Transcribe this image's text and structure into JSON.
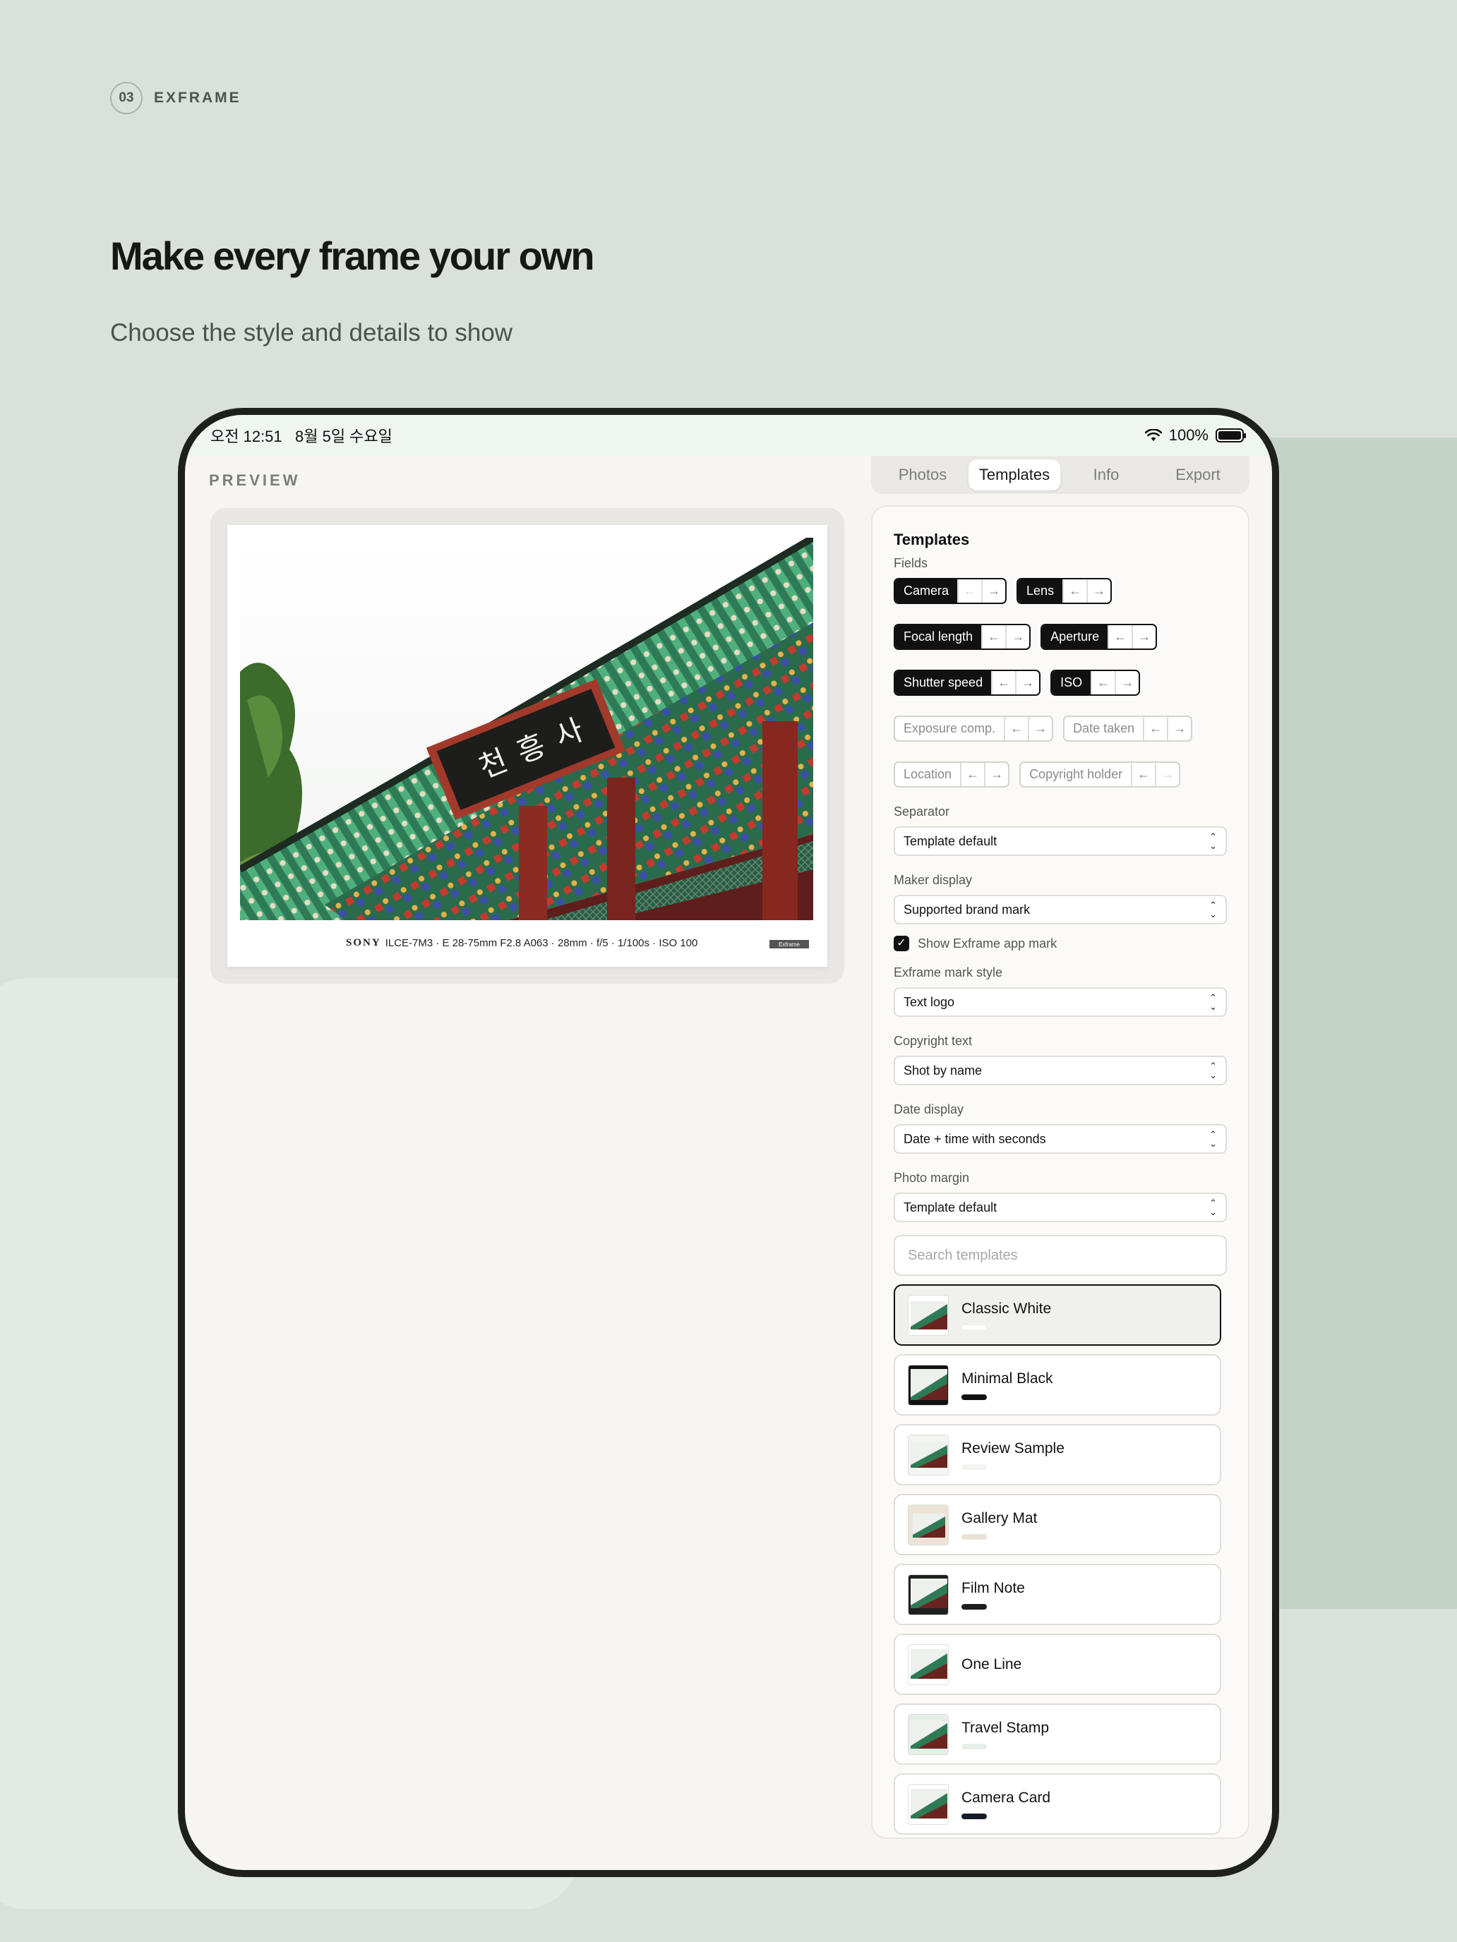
{
  "badge": {
    "number": "03",
    "label": "EXFRAME"
  },
  "headline": "Make every frame your own",
  "subhead": "Choose the style and details to show",
  "statusbar": {
    "time": "오전 12:51",
    "date": "8월 5일 수요일",
    "battery": "100%"
  },
  "preview": {
    "label": "PREVIEW",
    "caption_brand": "SONY",
    "caption_text": "ILCE-7M3 · E 28-75mm F2.8 A063 · 28mm · f/5 · 1/100s · ISO 100",
    "mark": "Exframe"
  },
  "tabs": [
    {
      "label": "Photos"
    },
    {
      "label": "Templates"
    },
    {
      "label": "Info"
    },
    {
      "label": "Export"
    }
  ],
  "panel": {
    "title": "Templates",
    "fields_label": "Fields",
    "fields": [
      {
        "name": "Camera",
        "on": true
      },
      {
        "name": "Lens",
        "on": true
      },
      {
        "name": "Focal length",
        "on": true
      },
      {
        "name": "Aperture",
        "on": true
      },
      {
        "name": "Shutter speed",
        "on": true
      },
      {
        "name": "ISO",
        "on": true
      },
      {
        "name": "Exposure comp.",
        "on": false
      },
      {
        "name": "Date taken",
        "on": false
      },
      {
        "name": "Location",
        "on": false
      },
      {
        "name": "Copyright holder",
        "on": false
      }
    ],
    "separator": {
      "label": "Separator",
      "value": "Template default"
    },
    "maker": {
      "label": "Maker display",
      "value": "Supported brand mark"
    },
    "show_mark": {
      "label": "Show Exframe app mark",
      "checked": true
    },
    "mark_style": {
      "label": "Exframe mark style",
      "value": "Text logo"
    },
    "copyright": {
      "label": "Copyright text",
      "value": "Shot by name"
    },
    "date_display": {
      "label": "Date display",
      "value": "Date + time with seconds"
    },
    "photo_margin": {
      "label": "Photo margin",
      "value": "Template default"
    },
    "search_placeholder": "Search templates",
    "templates": [
      {
        "name": "Classic White",
        "color": "#ffffff",
        "selected": true
      },
      {
        "name": "Minimal Black",
        "color": "#111111"
      },
      {
        "name": "Review Sample",
        "color": "#f2f2f0"
      },
      {
        "name": "Gallery Mat",
        "color": "#ece3d6"
      },
      {
        "name": "Film Note",
        "color": "#1f1f1f"
      },
      {
        "name": "One Line",
        "color": "#ffffff"
      },
      {
        "name": "Travel Stamp",
        "color": "#e3efe7"
      },
      {
        "name": "Camera Card",
        "color": "#161b2b"
      }
    ]
  }
}
